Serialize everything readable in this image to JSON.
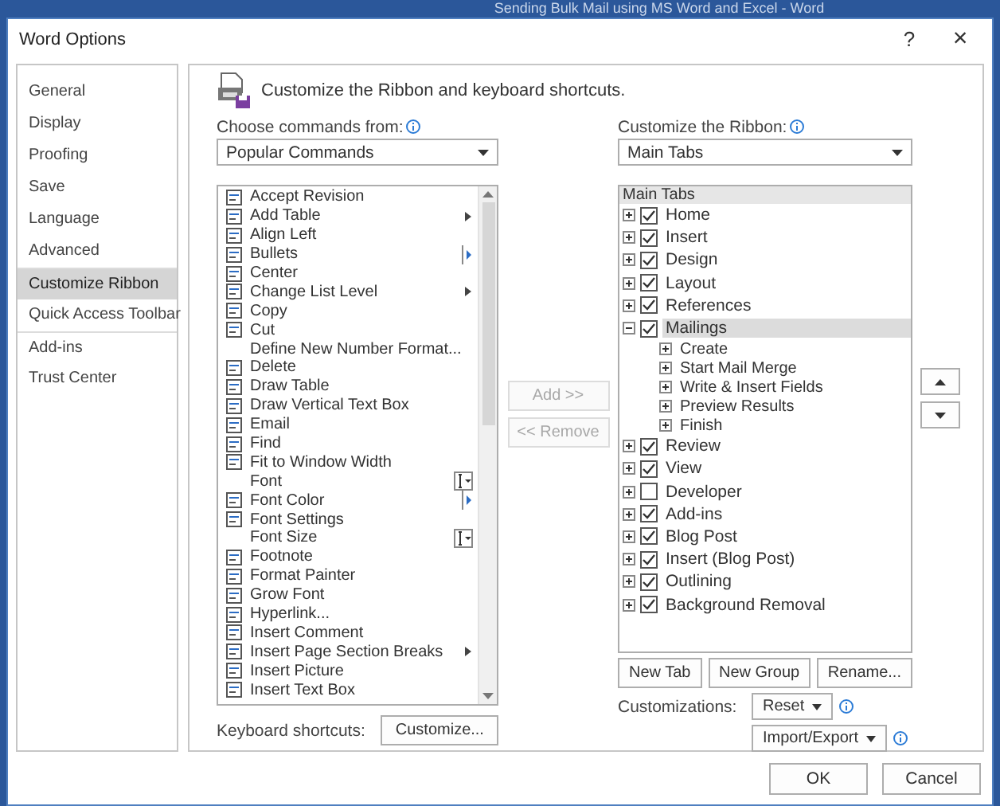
{
  "background_window": {
    "title": "Sending Bulk Mail using MS Word and Excel - Word"
  },
  "dialog": {
    "title": "Word Options",
    "help": "?",
    "close": "×"
  },
  "sidebar": {
    "items": [
      {
        "label": "General",
        "selected": false,
        "separator_before": false
      },
      {
        "label": "Display",
        "selected": false,
        "separator_before": false
      },
      {
        "label": "Proofing",
        "selected": false,
        "separator_before": false
      },
      {
        "label": "Save",
        "selected": false,
        "separator_before": false
      },
      {
        "label": "Language",
        "selected": false,
        "separator_before": false
      },
      {
        "label": "Advanced",
        "selected": false,
        "separator_before": false
      },
      {
        "label": "Customize Ribbon",
        "selected": true,
        "separator_before": true
      },
      {
        "label": "Quick Access Toolbar",
        "selected": false,
        "separator_before": false
      },
      {
        "label": "Add-ins",
        "selected": false,
        "separator_before": true
      },
      {
        "label": "Trust Center",
        "selected": false,
        "separator_before": false
      }
    ]
  },
  "header": {
    "title": "Customize the Ribbon and keyboard shortcuts."
  },
  "commands": {
    "label": "Choose commands from:",
    "dropdown": "Popular Commands",
    "items": [
      {
        "label": "Accept Revision",
        "has_icon": true,
        "kind": "plain"
      },
      {
        "label": "Add Table",
        "has_icon": true,
        "kind": "submenu"
      },
      {
        "label": "Align Left",
        "has_icon": true,
        "kind": "plain"
      },
      {
        "label": "Bullets",
        "has_icon": true,
        "kind": "split"
      },
      {
        "label": "Center",
        "has_icon": true,
        "kind": "plain"
      },
      {
        "label": "Change List Level",
        "has_icon": true,
        "kind": "submenu"
      },
      {
        "label": "Copy",
        "has_icon": true,
        "kind": "plain"
      },
      {
        "label": "Cut",
        "has_icon": true,
        "kind": "plain"
      },
      {
        "label": "Define New Number Format...",
        "has_icon": false,
        "kind": "plain"
      },
      {
        "label": "Delete",
        "has_icon": true,
        "kind": "plain"
      },
      {
        "label": "Draw Table",
        "has_icon": true,
        "kind": "plain"
      },
      {
        "label": "Draw Vertical Text Box",
        "has_icon": true,
        "kind": "plain"
      },
      {
        "label": "Email",
        "has_icon": true,
        "kind": "plain"
      },
      {
        "label": "Find",
        "has_icon": true,
        "kind": "plain"
      },
      {
        "label": "Fit to Window Width",
        "has_icon": true,
        "kind": "plain"
      },
      {
        "label": "Font",
        "has_icon": false,
        "kind": "combo"
      },
      {
        "label": "Font Color",
        "has_icon": true,
        "kind": "split"
      },
      {
        "label": "Font Settings",
        "has_icon": true,
        "kind": "plain"
      },
      {
        "label": "Font Size",
        "has_icon": false,
        "kind": "combo"
      },
      {
        "label": "Footnote",
        "has_icon": true,
        "kind": "plain"
      },
      {
        "label": "Format Painter",
        "has_icon": true,
        "kind": "plain"
      },
      {
        "label": "Grow Font",
        "has_icon": true,
        "kind": "plain"
      },
      {
        "label": "Hyperlink...",
        "has_icon": true,
        "kind": "plain"
      },
      {
        "label": "Insert Comment",
        "has_icon": true,
        "kind": "plain"
      },
      {
        "label": "Insert Page  Section Breaks",
        "has_icon": true,
        "kind": "submenu"
      },
      {
        "label": "Insert Picture",
        "has_icon": true,
        "kind": "plain"
      },
      {
        "label": "Insert Text Box",
        "has_icon": true,
        "kind": "plain"
      }
    ],
    "keyboard_label": "Keyboard shortcuts:",
    "customize_button": "Customize..."
  },
  "transfer": {
    "add": {
      "label": "Add >>",
      "disabled": true
    },
    "remove": {
      "label": "<< Remove",
      "disabled": true
    }
  },
  "ribbon": {
    "label": "Customize the Ribbon:",
    "dropdown": "Main Tabs",
    "tree_header": "Main Tabs",
    "tabs": [
      {
        "kind": "tab",
        "label": "Home",
        "checked": true,
        "expanded": false,
        "selected": false
      },
      {
        "kind": "tab",
        "label": "Insert",
        "checked": true,
        "expanded": false,
        "selected": false
      },
      {
        "kind": "tab",
        "label": "Design",
        "checked": true,
        "expanded": false,
        "selected": false
      },
      {
        "kind": "tab",
        "label": "Layout",
        "checked": true,
        "expanded": false,
        "selected": false
      },
      {
        "kind": "tab",
        "label": "References",
        "checked": true,
        "expanded": false,
        "selected": false
      },
      {
        "kind": "tab",
        "label": "Mailings",
        "checked": true,
        "expanded": true,
        "selected": true,
        "children": [
          {
            "kind": "group",
            "label": "Create",
            "expanded": false,
            "selected": false
          },
          {
            "kind": "group",
            "label": "Start Mail Merge",
            "expanded": false,
            "selected": false
          },
          {
            "kind": "group",
            "label": "Write & Insert Fields",
            "expanded": false,
            "selected": false
          },
          {
            "kind": "group",
            "label": "Preview Results",
            "expanded": false,
            "selected": false
          },
          {
            "kind": "group",
            "label": "Finish",
            "expanded": false,
            "selected": false
          }
        ]
      },
      {
        "kind": "tab",
        "label": "Review",
        "checked": true,
        "expanded": false,
        "selected": false
      },
      {
        "kind": "tab",
        "label": "View",
        "checked": true,
        "expanded": false,
        "selected": false
      },
      {
        "kind": "tab",
        "label": "Developer",
        "checked": false,
        "expanded": false,
        "selected": false
      },
      {
        "kind": "tab",
        "label": "Add-ins",
        "checked": true,
        "expanded": false,
        "selected": false
      },
      {
        "kind": "tab",
        "label": "Blog Post",
        "checked": true,
        "expanded": false,
        "selected": false
      },
      {
        "kind": "tab",
        "label": "Insert (Blog Post)",
        "checked": true,
        "expanded": false,
        "selected": false
      },
      {
        "kind": "tab",
        "label": "Outlining",
        "checked": true,
        "expanded": false,
        "selected": false
      },
      {
        "kind": "tab",
        "label": "Background Removal",
        "checked": true,
        "expanded": false,
        "selected": false
      }
    ],
    "buttons": [
      "New Tab",
      "New Group",
      "Rename..."
    ],
    "customizations_label": "Customizations:",
    "reset": "Reset",
    "import_export": "Import/Export"
  },
  "footer": {
    "buttons": [
      "OK",
      "Cancel"
    ]
  }
}
